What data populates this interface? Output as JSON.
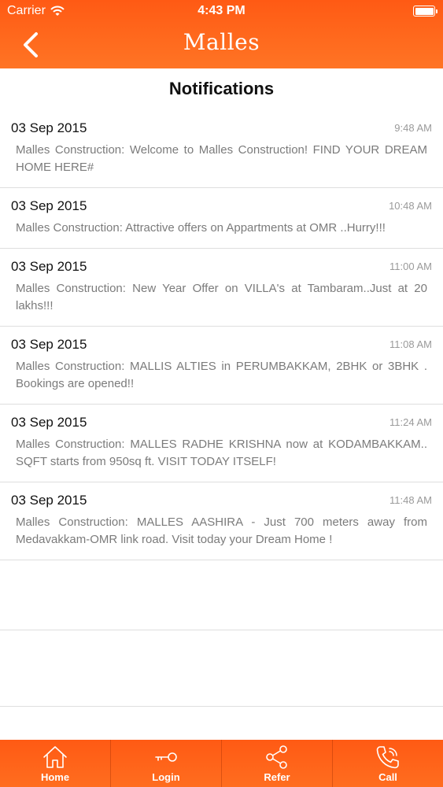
{
  "status_bar": {
    "carrier": "Carrier",
    "time": "4:43 PM"
  },
  "nav": {
    "title": "Malles"
  },
  "page": {
    "heading": "Notifications"
  },
  "notifications": [
    {
      "date": "03 Sep 2015",
      "time": "9:48 AM",
      "message": "Malles Construction: Welcome to Malles Construction! FIND YOUR DREAM HOME HERE#"
    },
    {
      "date": "03 Sep 2015",
      "time": "10:48 AM",
      "message": "Malles Construction: Attractive offers on Appartments at OMR ..Hurry!!!"
    },
    {
      "date": "03 Sep 2015",
      "time": "11:00 AM",
      "message": "Malles Construction: New Year Offer on VILLA's at Tambaram..Just at 20 lakhs!!!"
    },
    {
      "date": "03 Sep 2015",
      "time": "11:08 AM",
      "message": "Malles Construction: MALLIS ALTIES in PERUMBAKKAM, 2BHK or 3BHK . Bookings are opened!!"
    },
    {
      "date": "03 Sep 2015",
      "time": "11:24 AM",
      "message": "Malles Construction: MALLES RADHE KRISHNA now at KODAMBAKKAM.. SQFT starts from 950sq ft. VISIT TODAY ITSELF!"
    },
    {
      "date": "03 Sep 2015",
      "time": "11:48 AM",
      "message": "Malles Construction: MALLES AASHIRA - Just 700 meters away from Medavakkam-OMR link road. Visit today your Dream Home !"
    }
  ],
  "tabs": [
    {
      "label": "Home",
      "icon": "home-icon"
    },
    {
      "label": "Login",
      "icon": "key-icon"
    },
    {
      "label": "Refer",
      "icon": "share-icon"
    },
    {
      "label": "Call",
      "icon": "phone-icon"
    }
  ],
  "colors": {
    "brand_orange": "#ff6a1e",
    "text_dark": "#111111",
    "text_muted": "#7b7b7b",
    "time_gray": "#9a9a9a"
  }
}
